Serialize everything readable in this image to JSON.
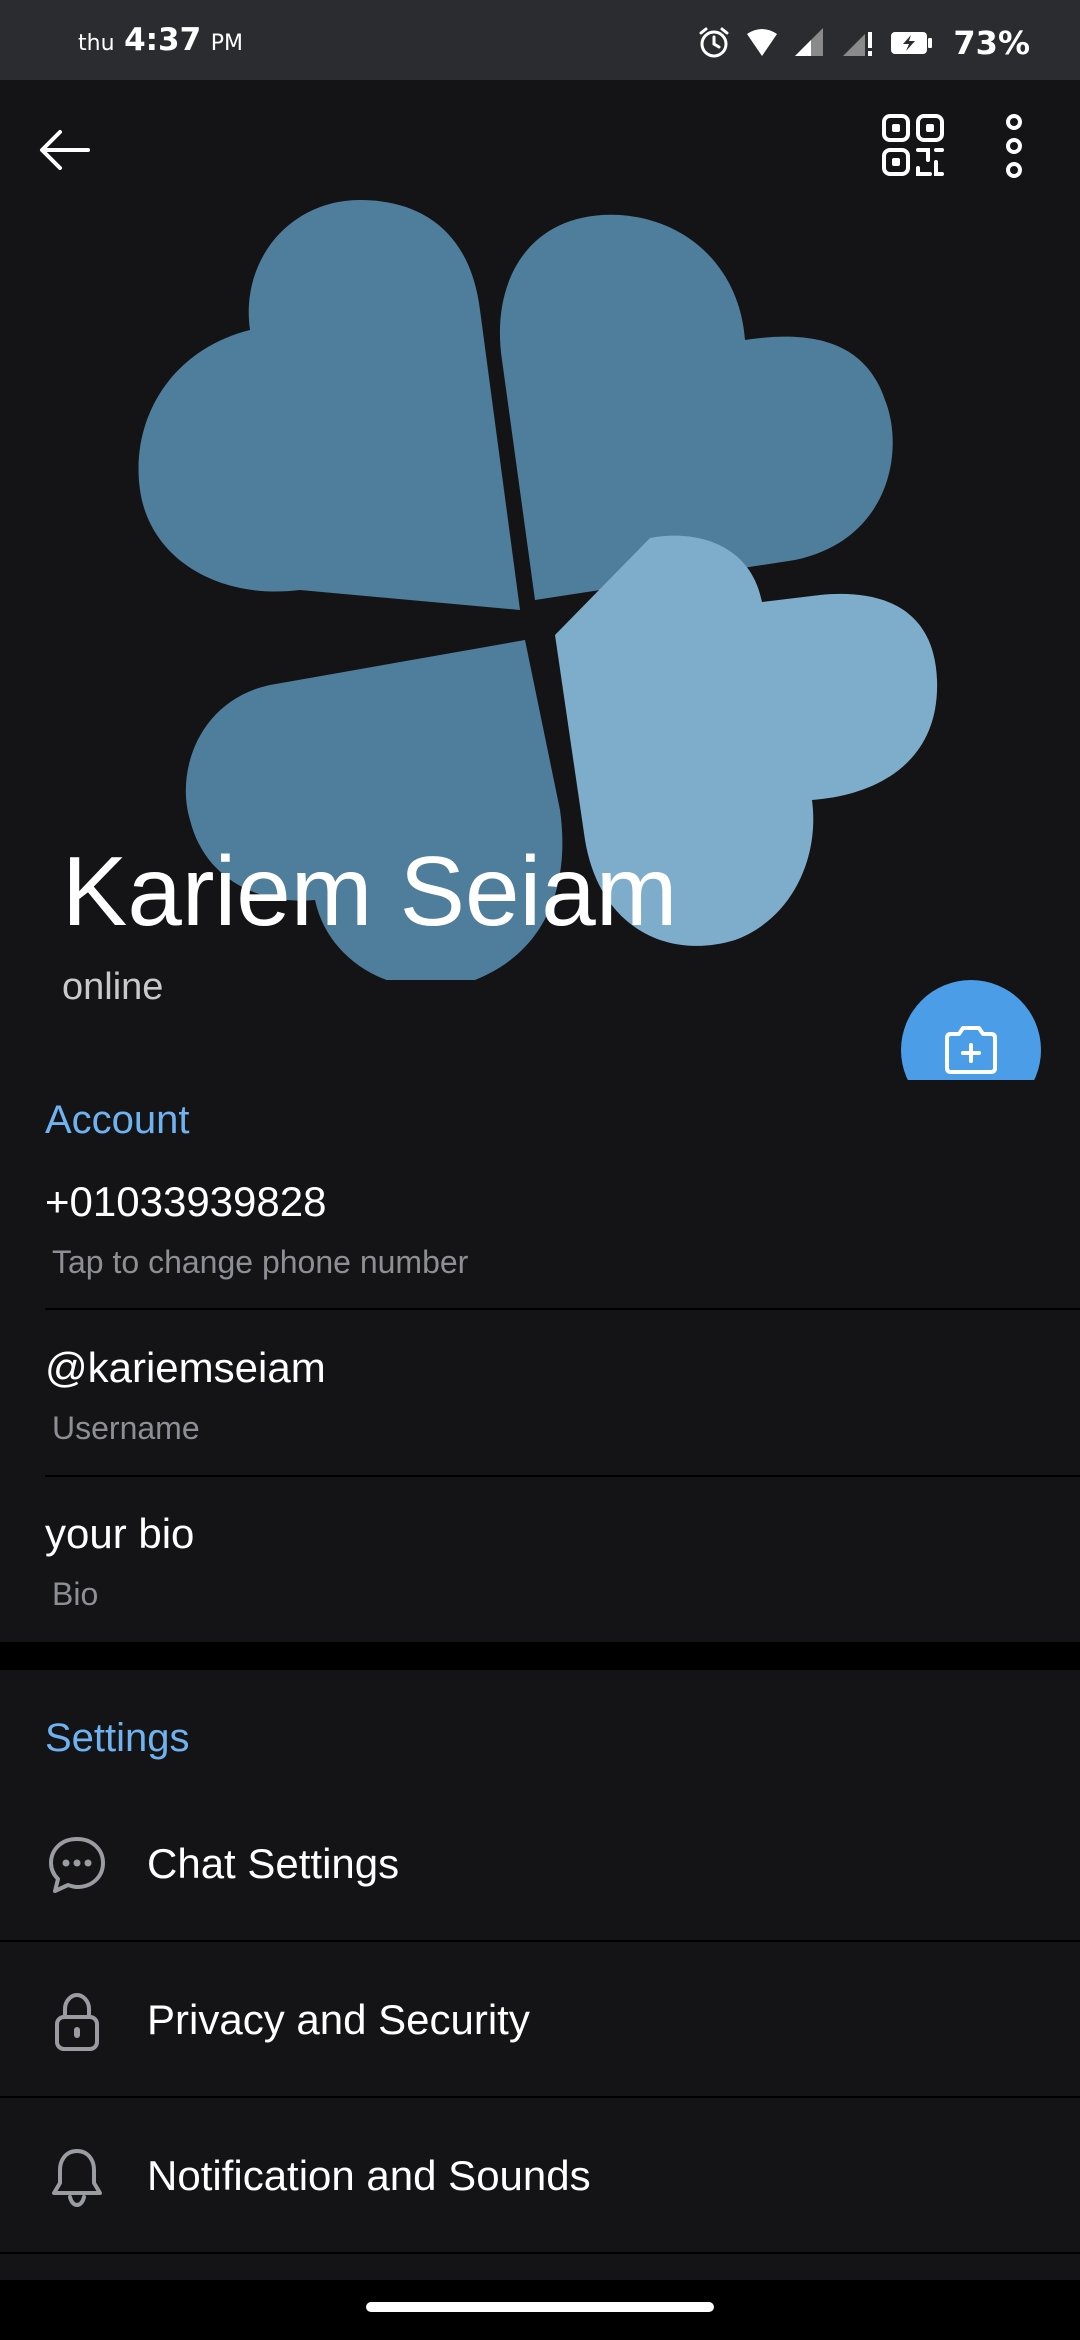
{
  "status_bar": {
    "day": "thu",
    "time": "4:37",
    "ampm": "PM",
    "battery": "73%"
  },
  "header": {
    "back_icon": "arrow-left-icon",
    "qr_icon": "qr-code-icon",
    "menu_icon": "more-vertical-icon"
  },
  "profile": {
    "name": "Kariem Seiam",
    "status": "online",
    "avatar_colors": [
      "#4f7d9c",
      "#7eadcb"
    ],
    "fab_icon": "add-photo-icon",
    "fab_color": "#4a9de6"
  },
  "account": {
    "title": "Account",
    "phone": "+01033939828",
    "phone_hint": "Tap to change phone number",
    "username": "@kariemseiam",
    "username_label": "Username",
    "bio": "your bio",
    "bio_label": "Bio"
  },
  "settings": {
    "title": "Settings",
    "items": [
      {
        "label": "Chat Settings",
        "icon": "chat-bubble-icon"
      },
      {
        "label": "Privacy and Security",
        "icon": "lock-icon"
      },
      {
        "label": "Notification and Sounds",
        "icon": "bell-icon"
      }
    ]
  },
  "accent_color": "#6fb2f0"
}
